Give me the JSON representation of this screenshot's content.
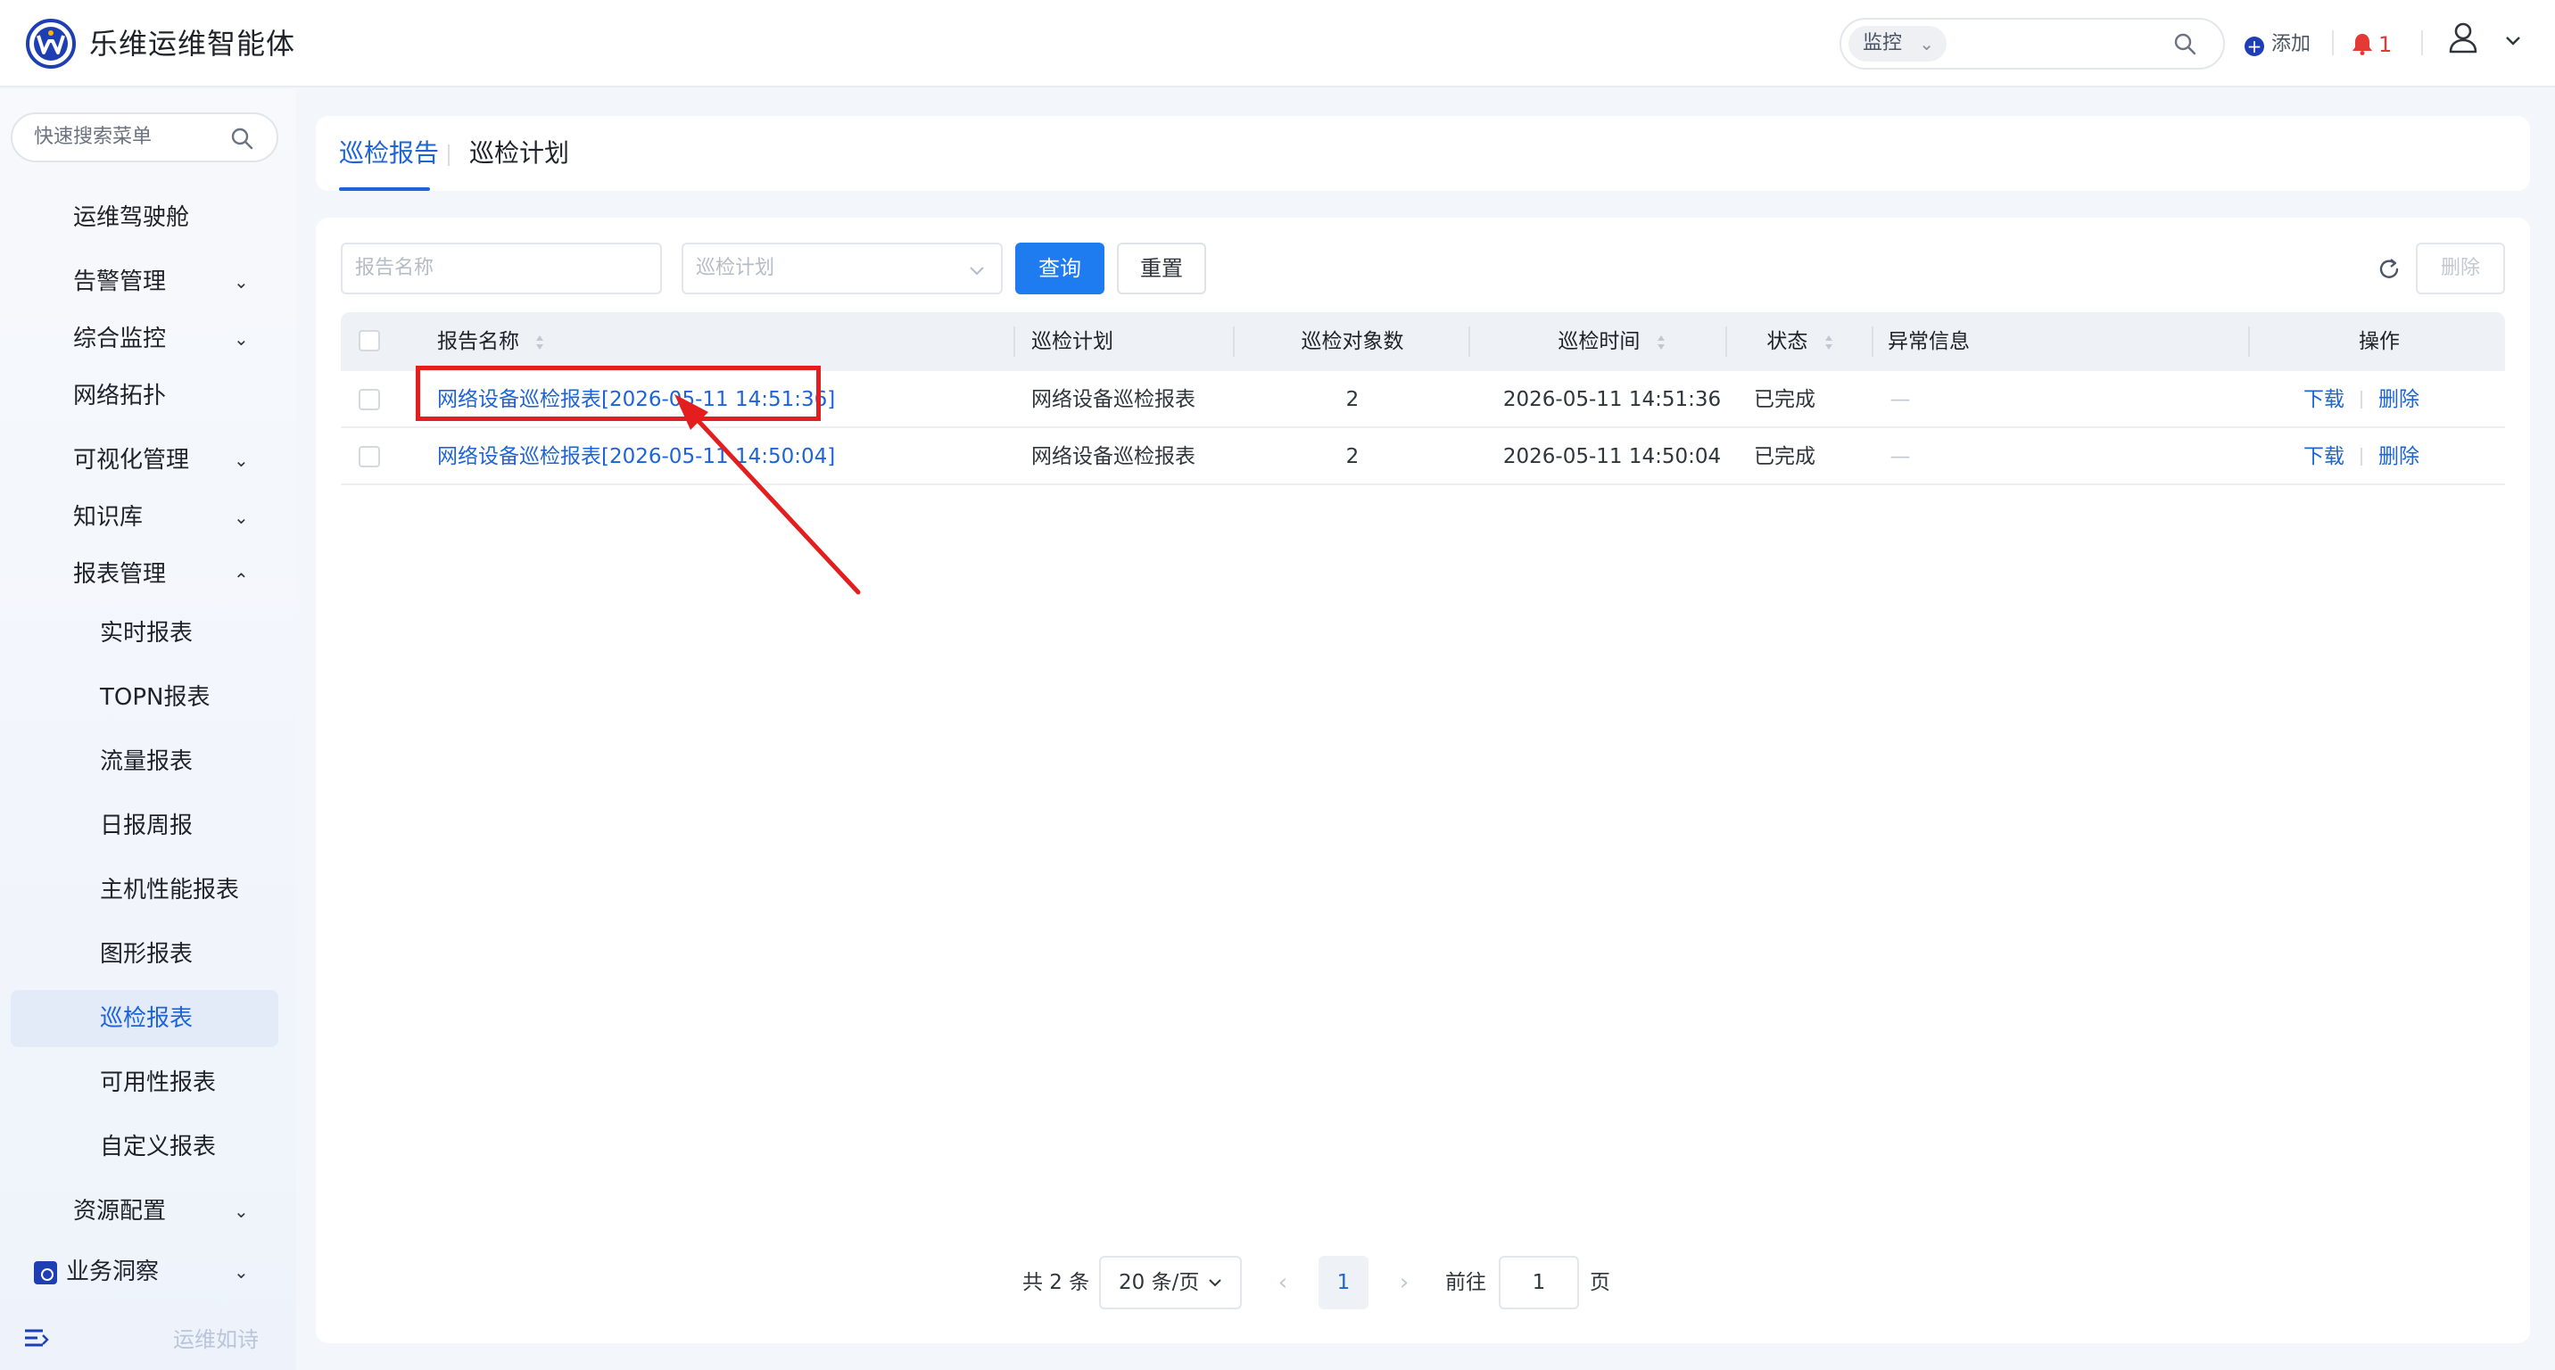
{
  "header": {
    "app_title": "乐维运维智能体",
    "search_scope": "监控",
    "add_label": "添加",
    "alert_count": "1",
    "brand_color": "#1d3fb3",
    "alert_color": "#e53935"
  },
  "sidebar": {
    "search_placeholder": "快速搜索菜单",
    "items": [
      {
        "label": "运维驾驶舱"
      },
      {
        "label": "告警管理"
      },
      {
        "label": "综合监控"
      },
      {
        "label": "网络拓扑"
      },
      {
        "label": "可视化管理"
      },
      {
        "label": "知识库"
      },
      {
        "label": "报表管理"
      },
      {
        "label": "资源配置"
      },
      {
        "label": "业务洞察"
      }
    ],
    "report_sub": [
      {
        "label": "实时报表"
      },
      {
        "label": "TOPN报表"
      },
      {
        "label": "流量报表"
      },
      {
        "label": "日报周报"
      },
      {
        "label": "主机性能报表"
      },
      {
        "label": "图形报表"
      },
      {
        "label": "巡检报表"
      },
      {
        "label": "可用性报表"
      },
      {
        "label": "自定义报表"
      }
    ],
    "footer_text": "运维如诗"
  },
  "tabs": [
    {
      "label": "巡检报告"
    },
    {
      "label": "巡检计划"
    }
  ],
  "filters": {
    "name_placeholder": "报告名称",
    "plan_placeholder": "巡检计划",
    "query_label": "查询",
    "reset_label": "重置",
    "delete_label": "删除"
  },
  "table": {
    "headers": [
      "报告名称",
      "巡检计划",
      "巡检对象数",
      "巡检时间",
      "状态",
      "异常信息",
      "操作"
    ],
    "rows": [
      {
        "name": "网络设备巡检报表[2026-05-11 14:51:36]",
        "plan": "网络设备巡检报表",
        "count": "2",
        "time": "2026-05-11 14:51:36",
        "status": "已完成",
        "error": "—",
        "download": "下载",
        "delete": "删除"
      },
      {
        "name": "网络设备巡检报表[2026-05-11 14:50:04]",
        "plan": "网络设备巡检报表",
        "count": "2",
        "time": "2026-05-11 14:50:04",
        "status": "已完成",
        "error": "—",
        "download": "下载",
        "delete": "删除"
      }
    ]
  },
  "pagination": {
    "total": "共 2 条",
    "page_size": "20 条/页",
    "current": "1",
    "goto_label": "前往",
    "goto_value": "1",
    "page_suffix": "页"
  },
  "annotation": {
    "highlight_color": "#e41e1e"
  }
}
